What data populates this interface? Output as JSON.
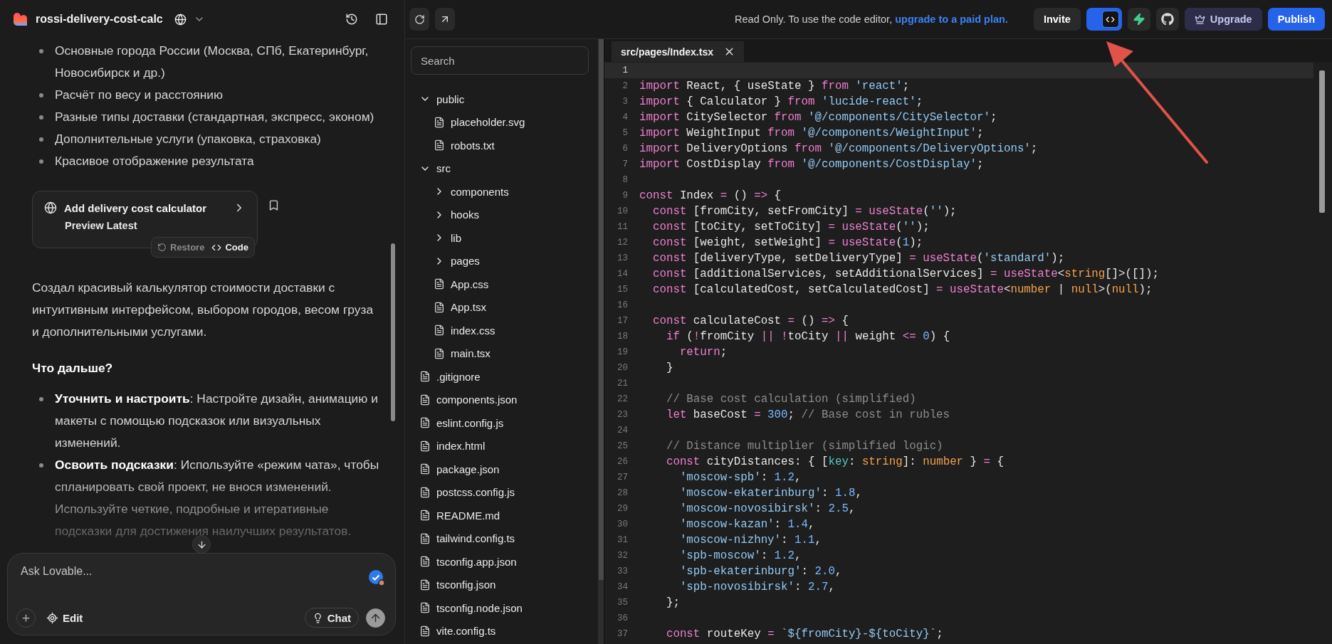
{
  "project": {
    "name": "rossi-delivery-cost-calc"
  },
  "chat": {
    "features": [
      "Основные города России (Москва, СПб, Екатеринбург, Новосибирск и др.)",
      "Расчёт по весу и расстоянию",
      "Разные типы доставки (стандартная, экспресс, эконом)",
      "Дополнительные услуги (упаковка, страховка)",
      "Красивое отображение результата"
    ],
    "card": {
      "title": "Add delivery cost calculator",
      "subtitle": "Preview Latest",
      "restore": "Restore",
      "code": "Code"
    },
    "summary": "Создал красивый калькулятор стоимости доставки с интуитивным интерфейсом, выбором городов, весом груза и дополнительными услугами.",
    "next_heading": "Что дальше?",
    "tips": [
      "**Уточнить и настроить**: Настройте дизайн, анимацию и макеты с помощью подсказок или визуальных изменений.",
      "**Освоить подсказки**: Используйте «режим чата», чтобы спланировать свой проект, не внося изменений. Используйте четкие, подробные и итеративные подсказки для достижения наилучших результатов."
    ],
    "composer": {
      "placeholder": "Ask Lovable...",
      "edit": "Edit",
      "chat": "Chat"
    }
  },
  "toolbar": {
    "notice": "Read Only. To use the code editor,",
    "notice_link": "upgrade to a paid plan.",
    "invite": "Invite",
    "view_toggle": {
      "selected": true
    },
    "upgrade": "Upgrade",
    "publish": "Publish"
  },
  "files": {
    "search_placeholder": "Search",
    "tree": [
      {
        "kind": "folder",
        "name": "public",
        "expanded": true,
        "children": [
          {
            "kind": "file",
            "name": "placeholder.svg"
          },
          {
            "kind": "file",
            "name": "robots.txt"
          }
        ]
      },
      {
        "kind": "folder",
        "name": "src",
        "expanded": true,
        "children": [
          {
            "kind": "folder",
            "name": "components",
            "expanded": false
          },
          {
            "kind": "folder",
            "name": "hooks",
            "expanded": false
          },
          {
            "kind": "folder",
            "name": "lib",
            "expanded": false
          },
          {
            "kind": "folder",
            "name": "pages",
            "expanded": false
          },
          {
            "kind": "file",
            "name": "App.css"
          },
          {
            "kind": "file",
            "name": "App.tsx"
          },
          {
            "kind": "file",
            "name": "index.css"
          },
          {
            "kind": "file",
            "name": "main.tsx"
          }
        ]
      },
      {
        "kind": "file",
        "name": ".gitignore"
      },
      {
        "kind": "file",
        "name": "components.json"
      },
      {
        "kind": "file",
        "name": "eslint.config.js"
      },
      {
        "kind": "file",
        "name": "index.html"
      },
      {
        "kind": "file",
        "name": "package.json"
      },
      {
        "kind": "file",
        "name": "postcss.config.js"
      },
      {
        "kind": "file",
        "name": "README.md"
      },
      {
        "kind": "file",
        "name": "tailwind.config.ts"
      },
      {
        "kind": "file",
        "name": "tsconfig.app.json"
      },
      {
        "kind": "file",
        "name": "tsconfig.json"
      },
      {
        "kind": "file",
        "name": "tsconfig.node.json"
      },
      {
        "kind": "file",
        "name": "vite.config.ts"
      }
    ]
  },
  "editor": {
    "tab": "src/pages/Index.tsx",
    "lines": [
      {
        "number": "1",
        "current": true
      },
      {
        "number": "2",
        "current": false,
        "tokens": [
          {
            "kind": "kw",
            "text": "import"
          },
          {
            "kind": "txt",
            "text": " React, { useState } "
          },
          {
            "kind": "kw",
            "text": "from"
          },
          {
            "kind": "str",
            "text": " 'react'"
          },
          {
            "kind": "txt",
            "text": ";"
          }
        ]
      },
      {
        "number": "3",
        "current": false,
        "tokens": [
          {
            "kind": "kw",
            "text": "import"
          },
          {
            "kind": "txt",
            "text": " { Calculator } "
          },
          {
            "kind": "kw",
            "text": "from"
          },
          {
            "kind": "str",
            "text": " 'lucide-react'"
          },
          {
            "kind": "txt",
            "text": ";"
          }
        ]
      },
      {
        "number": "4",
        "current": false,
        "tokens": [
          {
            "kind": "kw",
            "text": "import"
          },
          {
            "kind": "txt",
            "text": " CitySelector "
          },
          {
            "kind": "kw",
            "text": "from"
          },
          {
            "kind": "str",
            "text": " '@/components/CitySelector'"
          },
          {
            "kind": "txt",
            "text": ";"
          }
        ]
      },
      {
        "number": "5",
        "current": false,
        "tokens": [
          {
            "kind": "kw",
            "text": "import"
          },
          {
            "kind": "txt",
            "text": " WeightInput "
          },
          {
            "kind": "kw",
            "text": "from"
          },
          {
            "kind": "str",
            "text": " '@/components/WeightInput'"
          },
          {
            "kind": "txt",
            "text": ";"
          }
        ]
      },
      {
        "number": "6",
        "current": false,
        "tokens": [
          {
            "kind": "kw",
            "text": "import"
          },
          {
            "kind": "txt",
            "text": " DeliveryOptions "
          },
          {
            "kind": "kw",
            "text": "from"
          },
          {
            "kind": "str",
            "text": " '@/components/DeliveryOptions'"
          },
          {
            "kind": "txt",
            "text": ";"
          }
        ]
      },
      {
        "number": "7",
        "current": false,
        "tokens": [
          {
            "kind": "kw",
            "text": "import"
          },
          {
            "kind": "txt",
            "text": " CostDisplay "
          },
          {
            "kind": "kw",
            "text": "from"
          },
          {
            "kind": "str",
            "text": " '@/components/CostDisplay'"
          },
          {
            "kind": "txt",
            "text": ";"
          }
        ]
      },
      {
        "number": "8",
        "current": false
      },
      {
        "number": "9",
        "current": false,
        "tokens": [
          {
            "kind": "kw",
            "text": "const"
          },
          {
            "kind": "txt",
            "text": " Index "
          },
          {
            "kind": "op",
            "text": "="
          },
          {
            "kind": "txt",
            "text": " () "
          },
          {
            "kind": "op",
            "text": "=>"
          },
          {
            "kind": "txt",
            "text": " {"
          }
        ]
      },
      {
        "number": "10",
        "current": false,
        "tokens": [
          {
            "kind": "kw",
            "text": "  const"
          },
          {
            "kind": "txt",
            "text": " [fromCity, setFromCity] "
          },
          {
            "kind": "op",
            "text": "="
          },
          {
            "kind": "fn",
            "text": " useState"
          },
          {
            "kind": "txt",
            "text": "("
          },
          {
            "kind": "str",
            "text": "''"
          },
          {
            "kind": "txt",
            "text": ");"
          }
        ]
      },
      {
        "number": "11",
        "current": false,
        "tokens": [
          {
            "kind": "kw",
            "text": "  const"
          },
          {
            "kind": "txt",
            "text": " [toCity, setToCity] "
          },
          {
            "kind": "op",
            "text": "="
          },
          {
            "kind": "fn",
            "text": " useState"
          },
          {
            "kind": "txt",
            "text": "("
          },
          {
            "kind": "str",
            "text": "''"
          },
          {
            "kind": "txt",
            "text": ");"
          }
        ]
      },
      {
        "number": "12",
        "current": false,
        "tokens": [
          {
            "kind": "kw",
            "text": "  const"
          },
          {
            "kind": "txt",
            "text": " [weight, setWeight] "
          },
          {
            "kind": "op",
            "text": "="
          },
          {
            "kind": "fn",
            "text": " useState"
          },
          {
            "kind": "txt",
            "text": "("
          },
          {
            "kind": "num",
            "text": "1"
          },
          {
            "kind": "txt",
            "text": ");"
          }
        ]
      },
      {
        "number": "13",
        "current": false,
        "tokens": [
          {
            "kind": "kw",
            "text": "  const"
          },
          {
            "kind": "txt",
            "text": " [deliveryType, setDeliveryType] "
          },
          {
            "kind": "op",
            "text": "="
          },
          {
            "kind": "fn",
            "text": " useState"
          },
          {
            "kind": "txt",
            "text": "("
          },
          {
            "kind": "str",
            "text": "'standard'"
          },
          {
            "kind": "txt",
            "text": ");"
          }
        ]
      },
      {
        "number": "14",
        "current": false,
        "tokens": [
          {
            "kind": "kw",
            "text": "  const"
          },
          {
            "kind": "txt",
            "text": " [additionalServices, setAdditionalServices] "
          },
          {
            "kind": "op",
            "text": "="
          },
          {
            "kind": "fn",
            "text": " useState"
          },
          {
            "kind": "txt",
            "text": "<"
          },
          {
            "kind": "type",
            "text": "string"
          },
          {
            "kind": "txt",
            "text": "[]>([]);"
          }
        ]
      },
      {
        "number": "15",
        "current": false,
        "tokens": [
          {
            "kind": "kw",
            "text": "  const"
          },
          {
            "kind": "txt",
            "text": " [calculatedCost, setCalculatedCost] "
          },
          {
            "kind": "op",
            "text": "="
          },
          {
            "kind": "fn",
            "text": " useState"
          },
          {
            "kind": "txt",
            "text": "<"
          },
          {
            "kind": "type",
            "text": "number"
          },
          {
            "kind": "txt",
            "text": " | "
          },
          {
            "kind": "type",
            "text": "null"
          },
          {
            "kind": "txt",
            "text": ">("
          },
          {
            "kind": "type",
            "text": "null"
          },
          {
            "kind": "txt",
            "text": ");"
          }
        ]
      },
      {
        "number": "16",
        "current": false
      },
      {
        "number": "17",
        "current": false,
        "tokens": [
          {
            "kind": "kw",
            "text": "  const"
          },
          {
            "kind": "txt",
            "text": " calculateCost "
          },
          {
            "kind": "op",
            "text": "="
          },
          {
            "kind": "txt",
            "text": " () "
          },
          {
            "kind": "op",
            "text": "=>"
          },
          {
            "kind": "txt",
            "text": " {"
          }
        ]
      },
      {
        "number": "18",
        "current": false,
        "tokens": [
          {
            "kind": "kw",
            "text": "    if"
          },
          {
            "kind": "txt",
            "text": " ("
          },
          {
            "kind": "op",
            "text": "!"
          },
          {
            "kind": "txt",
            "text": "fromCity "
          },
          {
            "kind": "op",
            "text": "||"
          },
          {
            "kind": "op",
            "text": " !"
          },
          {
            "kind": "txt",
            "text": "toCity "
          },
          {
            "kind": "op",
            "text": "||"
          },
          {
            "kind": "txt",
            "text": " weight "
          },
          {
            "kind": "op",
            "text": "<="
          },
          {
            "kind": "num",
            "text": " 0"
          },
          {
            "kind": "txt",
            "text": ") {"
          }
        ]
      },
      {
        "number": "19",
        "current": false,
        "tokens": [
          {
            "kind": "kw",
            "text": "      return"
          },
          {
            "kind": "txt",
            "text": ";"
          }
        ]
      },
      {
        "number": "20",
        "current": false,
        "tokens": [
          {
            "kind": "txt",
            "text": "    }"
          }
        ]
      },
      {
        "number": "21",
        "current": false
      },
      {
        "number": "22",
        "current": false,
        "tokens": [
          {
            "kind": "com",
            "text": "    // Base cost calculation (simplified)"
          }
        ]
      },
      {
        "number": "23",
        "current": false,
        "tokens": [
          {
            "kind": "kw",
            "text": "    let"
          },
          {
            "kind": "txt",
            "text": " baseCost "
          },
          {
            "kind": "op",
            "text": "="
          },
          {
            "kind": "num",
            "text": " 300"
          },
          {
            "kind": "txt",
            "text": ";"
          },
          {
            "kind": "com",
            "text": " // Base cost in rubles"
          }
        ]
      },
      {
        "number": "24",
        "current": false
      },
      {
        "number": "25",
        "current": false,
        "tokens": [
          {
            "kind": "com",
            "text": "    // Distance multiplier (simplified logic)"
          }
        ]
      },
      {
        "number": "26",
        "current": false,
        "tokens": [
          {
            "kind": "kw",
            "text": "    const"
          },
          {
            "kind": "txt",
            "text": " cityDistances: { ["
          },
          {
            "kind": "prop",
            "text": "key"
          },
          {
            "kind": "txt",
            "text": ": "
          },
          {
            "kind": "type",
            "text": "string"
          },
          {
            "kind": "txt",
            "text": "]: "
          },
          {
            "kind": "type",
            "text": "number"
          },
          {
            "kind": "txt",
            "text": " } "
          },
          {
            "kind": "op",
            "text": "="
          },
          {
            "kind": "txt",
            "text": " {"
          }
        ]
      },
      {
        "number": "27",
        "current": false,
        "tokens": [
          {
            "kind": "str",
            "text": "      'moscow-spb'"
          },
          {
            "kind": "txt",
            "text": ": "
          },
          {
            "kind": "num",
            "text": "1.2"
          },
          {
            "kind": "txt",
            "text": ","
          }
        ]
      },
      {
        "number": "28",
        "current": false,
        "tokens": [
          {
            "kind": "str",
            "text": "      'moscow-ekaterinburg'"
          },
          {
            "kind": "txt",
            "text": ": "
          },
          {
            "kind": "num",
            "text": "1.8"
          },
          {
            "kind": "txt",
            "text": ","
          }
        ]
      },
      {
        "number": "29",
        "current": false,
        "tokens": [
          {
            "kind": "str",
            "text": "      'moscow-novosibirsk'"
          },
          {
            "kind": "txt",
            "text": ": "
          },
          {
            "kind": "num",
            "text": "2.5"
          },
          {
            "kind": "txt",
            "text": ","
          }
        ]
      },
      {
        "number": "30",
        "current": false,
        "tokens": [
          {
            "kind": "str",
            "text": "      'moscow-kazan'"
          },
          {
            "kind": "txt",
            "text": ": "
          },
          {
            "kind": "num",
            "text": "1.4"
          },
          {
            "kind": "txt",
            "text": ","
          }
        ]
      },
      {
        "number": "31",
        "current": false,
        "tokens": [
          {
            "kind": "str",
            "text": "      'moscow-nizhny'"
          },
          {
            "kind": "txt",
            "text": ": "
          },
          {
            "kind": "num",
            "text": "1.1"
          },
          {
            "kind": "txt",
            "text": ","
          }
        ]
      },
      {
        "number": "32",
        "current": false,
        "tokens": [
          {
            "kind": "str",
            "text": "      'spb-moscow'"
          },
          {
            "kind": "txt",
            "text": ": "
          },
          {
            "kind": "num",
            "text": "1.2"
          },
          {
            "kind": "txt",
            "text": ","
          }
        ]
      },
      {
        "number": "33",
        "current": false,
        "tokens": [
          {
            "kind": "str",
            "text": "      'spb-ekaterinburg'"
          },
          {
            "kind": "txt",
            "text": ": "
          },
          {
            "kind": "num",
            "text": "2.0"
          },
          {
            "kind": "txt",
            "text": ","
          }
        ]
      },
      {
        "number": "34",
        "current": false,
        "tokens": [
          {
            "kind": "str",
            "text": "      'spb-novosibirsk'"
          },
          {
            "kind": "txt",
            "text": ": "
          },
          {
            "kind": "num",
            "text": "2.7"
          },
          {
            "kind": "txt",
            "text": ","
          }
        ]
      },
      {
        "number": "35",
        "current": false,
        "tokens": [
          {
            "kind": "txt",
            "text": "    };"
          }
        ]
      },
      {
        "number": "36",
        "current": false
      },
      {
        "number": "37",
        "current": false,
        "tokens": [
          {
            "kind": "kw",
            "text": "    const"
          },
          {
            "kind": "txt",
            "text": " routeKey "
          },
          {
            "kind": "op",
            "text": "="
          },
          {
            "kind": "str",
            "text": " `${fromCity}-${toCity}`"
          },
          {
            "kind": "txt",
            "text": ";"
          }
        ]
      }
    ]
  }
}
